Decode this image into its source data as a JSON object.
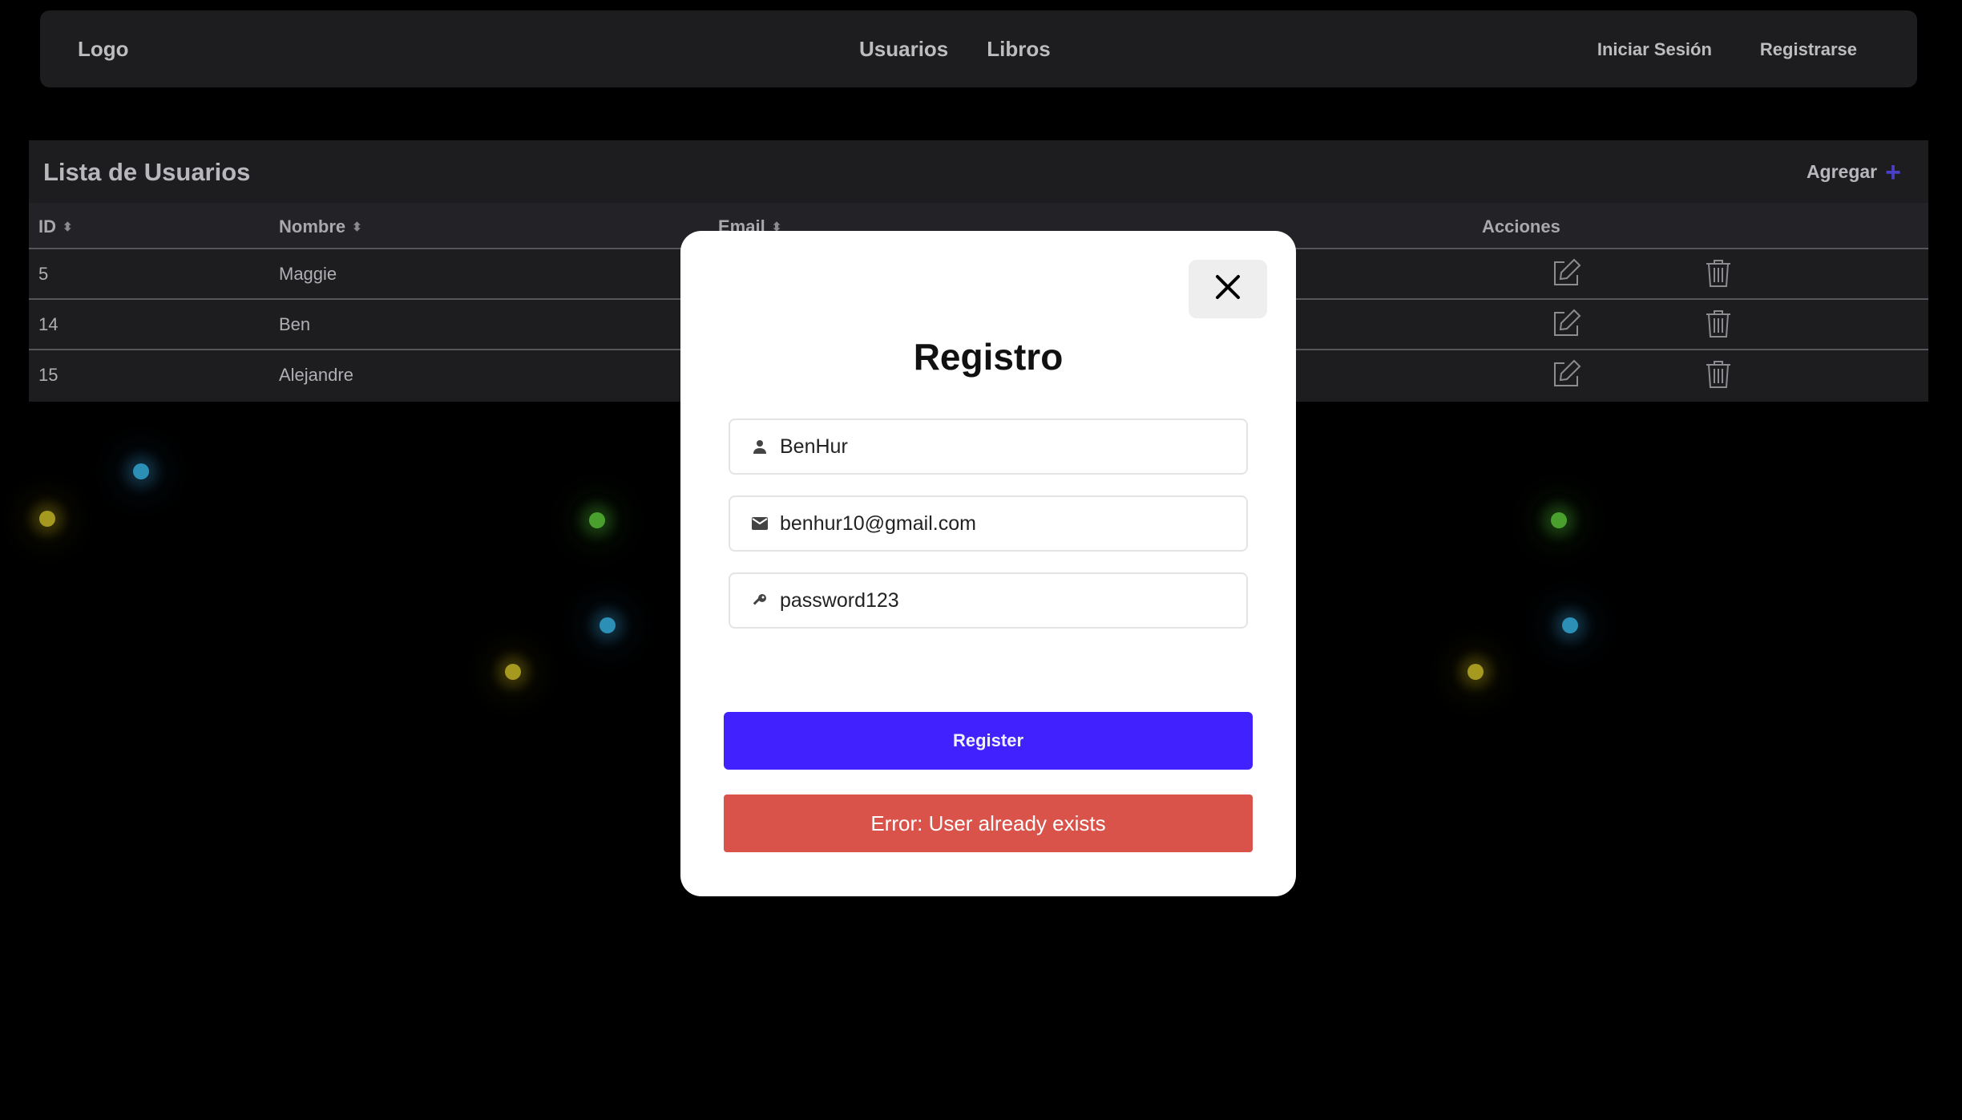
{
  "navbar": {
    "logo": "Logo",
    "links": [
      "Usuarios",
      "Libros"
    ],
    "login": "Iniciar Sesión",
    "register": "Registrarse"
  },
  "users_table": {
    "title": "Lista de Usuarios",
    "add_label": "Agregar",
    "columns": [
      "ID",
      "Nombre",
      "Email",
      "Acciones"
    ],
    "rows": [
      {
        "id": "5",
        "name": "Maggie"
      },
      {
        "id": "14",
        "name": "Ben"
      },
      {
        "id": "15",
        "name": "Alejandre"
      }
    ]
  },
  "modal": {
    "title": "Registro",
    "username_value": "BenHur",
    "email_value": "benhur10@gmail.com",
    "password_value": "password123",
    "register_label": "Register",
    "error_message": "Error: User already exists"
  },
  "colors": {
    "accent": "#4221ff",
    "error": "#d9534b",
    "add_plus": "#4a3fc7"
  },
  "icons": {
    "close": "close-icon",
    "user": "user-icon",
    "mail": "mail-icon",
    "key": "key-icon",
    "edit": "edit-icon",
    "trash": "trash-icon",
    "sort": "sort-icon",
    "plus": "plus-icon"
  }
}
